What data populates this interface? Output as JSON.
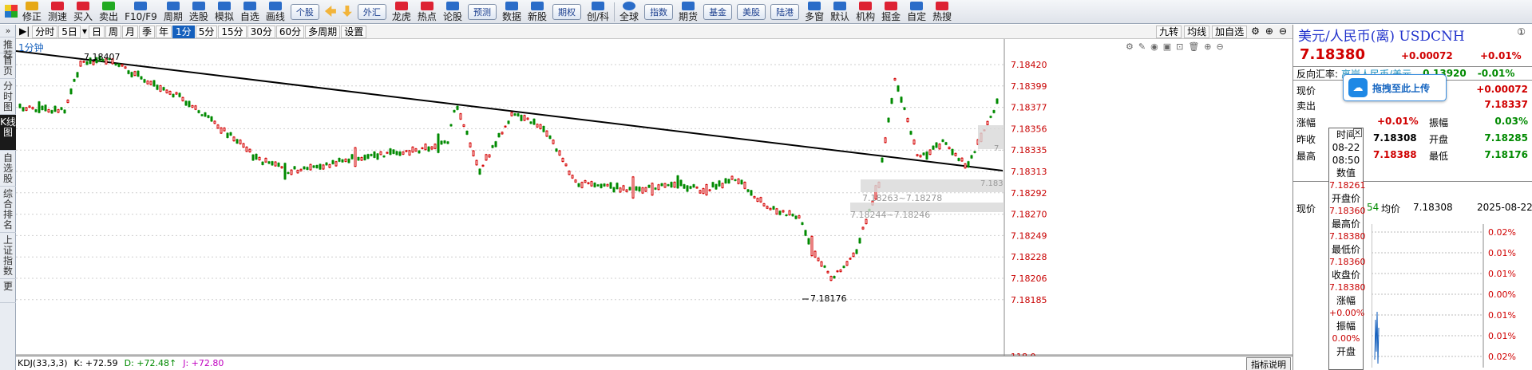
{
  "toolbar": {
    "items": [
      {
        "label": "修正",
        "icon": "repair-icon",
        "color": "#e6a817"
      },
      {
        "label": "测速",
        "icon": "speedtest-icon",
        "color": "#d23"
      },
      {
        "label": "买入",
        "icon": "buy-icon",
        "color": "#d23"
      },
      {
        "label": "卖出",
        "icon": "sell-icon",
        "color": "#2a2"
      },
      {
        "label": "F10/F9",
        "icon": "f10-icon",
        "color": "#2a6cc8"
      },
      {
        "label": "周期",
        "icon": "period-icon",
        "color": "#2a6cc8"
      },
      {
        "label": "选股",
        "icon": "stock-picker-icon",
        "color": "#2a6cc8"
      },
      {
        "label": "模拟",
        "icon": "simulate-icon",
        "color": "#2a6cc8"
      },
      {
        "label": "自选",
        "icon": "favorites-icon",
        "color": "#2a6cc8"
      },
      {
        "label": "画线",
        "icon": "draw-line-icon",
        "color": "#2a6cc8"
      }
    ],
    "btn_gegu": "个股",
    "items2": [
      {
        "label": "外汇",
        "icon": "forex-icon",
        "color": "#e6a817"
      },
      {
        "label": "龙虎",
        "icon": "dragon-tiger-icon",
        "color": "#d23"
      },
      {
        "label": "热点",
        "icon": "hotspot-icon",
        "color": "#d23"
      },
      {
        "label": "论股",
        "icon": "discuss-icon",
        "color": "#2a6cc8"
      }
    ],
    "btn_yuce": "预测",
    "items3": [
      {
        "label": "数据",
        "icon": "data-icon",
        "color": "#2a6cc8"
      },
      {
        "label": "新股",
        "icon": "ipo-icon",
        "color": "#2a6cc8"
      }
    ],
    "btn_qihuo": "期权",
    "item_chuangke": {
      "label": "创/科",
      "icon": "star-market-icon",
      "color": "#2a6cc8"
    },
    "item_quanqiu": {
      "label": "全球",
      "icon": "global-icon",
      "color": "#2a6cc8"
    },
    "btn_zhishu": "指数",
    "item_qihuo": {
      "label": "期货",
      "icon": "futures-icon",
      "color": "#2a6cc8"
    },
    "btns_right": [
      "基金",
      "美股",
      "陆港"
    ],
    "items_right": [
      {
        "label": "多窗",
        "icon": "multi-window-icon",
        "color": "#2a6cc8"
      },
      {
        "label": "默认",
        "icon": "default-layout-icon",
        "color": "#2a6cc8"
      },
      {
        "label": "机构",
        "icon": "institution-icon",
        "color": "#d23"
      },
      {
        "label": "掘金",
        "icon": "gold-icon",
        "color": "#d23"
      },
      {
        "label": "自定",
        "icon": "custom-icon",
        "color": "#2a6cc8"
      },
      {
        "label": "热搜",
        "icon": "hot-search-icon",
        "color": "#d23"
      }
    ]
  },
  "leftnav": [
    "推荐",
    "首页",
    "分时图",
    "K线图",
    "自选股",
    "综合排名",
    "上证指数",
    "更"
  ],
  "periodbar": {
    "items": [
      "分时",
      "5日",
      "日",
      "周",
      "月",
      "季",
      "年",
      "1分",
      "5分",
      "15分",
      "30分",
      "60分",
      "多周期",
      "设置"
    ],
    "active": "1分",
    "right": [
      "九转",
      "均线",
      "加自选"
    ]
  },
  "chart": {
    "label": "1分钟",
    "axis_labels": [
      "7.18420",
      "7.18399",
      "7.18377",
      "7.18356",
      "7.18335",
      "7.18313",
      "7.18292",
      "7.18270",
      "7.18249",
      "7.18228",
      "7.18206",
      "7.18185",
      "118.0"
    ],
    "high_label": "7.18407",
    "low_label": "7.18176",
    "range_label_1": "7.18263~7.18278",
    "range_label_2": "7.18244~7.18246",
    "right_cut_label_1": "7.",
    "right_cut_label_2": "7.183",
    "up_color": "#d40000",
    "down_color": "#008a00"
  },
  "indicator": {
    "name": "KDJ(33,3,3)",
    "k": "K: +72.59",
    "d": "D: +72.48↑",
    "j": "J: +72.80",
    "help": "指标说明"
  },
  "right": {
    "title": "美元/人民币(离) USDCNH",
    "close": "①",
    "price": "7.18380",
    "change": "+0.00072",
    "change_pct": "+0.01%",
    "reverse_label": "反向汇率:",
    "reverse_name": "离岸人民币/美元",
    "reverse_value": "0.13920",
    "reverse_pct": "-0.01%",
    "upload": "拖拽至此上传",
    "rows": [
      {
        "l1": "现价",
        "v2": "+0.00072"
      },
      {
        "l1": "卖出",
        "v2": "7.18337"
      },
      {
        "l1": "涨幅",
        "v1": "+0.01%",
        "l2": "振幅",
        "v2": "0.03%"
      },
      {
        "l1": "昨收",
        "v1": "7.18308",
        "l2": "开盘",
        "v2": "7.18285"
      },
      {
        "l1": "最高",
        "v1": "7.18388",
        "l2": "最低",
        "v2": "7.18176"
      }
    ],
    "bottom": {
      "label": "现价",
      "num": "54",
      "avg_label": "均价",
      "avg": "7.18308",
      "date": "2025-08-22"
    },
    "mini_pcts": [
      "0.02%",
      "0.01%",
      "0.01%",
      "0.00%",
      "0.01%",
      "0.01%",
      "0.02%"
    ]
  },
  "tooltip": {
    "items": [
      {
        "label": "时间",
        "value": "08-22"
      },
      {
        "label": "",
        "value": "08:50"
      },
      {
        "label": "数值",
        "value": "7.18261"
      },
      {
        "label": "开盘价",
        "value": "7.18360"
      },
      {
        "label": "最高价",
        "value": "7.18380"
      },
      {
        "label": "最低价",
        "value": "7.18360"
      },
      {
        "label": "收盘价",
        "value": "7.18380"
      },
      {
        "label": "涨幅",
        "value": "+0.00%"
      },
      {
        "label": "振幅",
        "value": "0.00%"
      },
      {
        "label": "开盘",
        "value": ""
      }
    ],
    "close": "×"
  }
}
